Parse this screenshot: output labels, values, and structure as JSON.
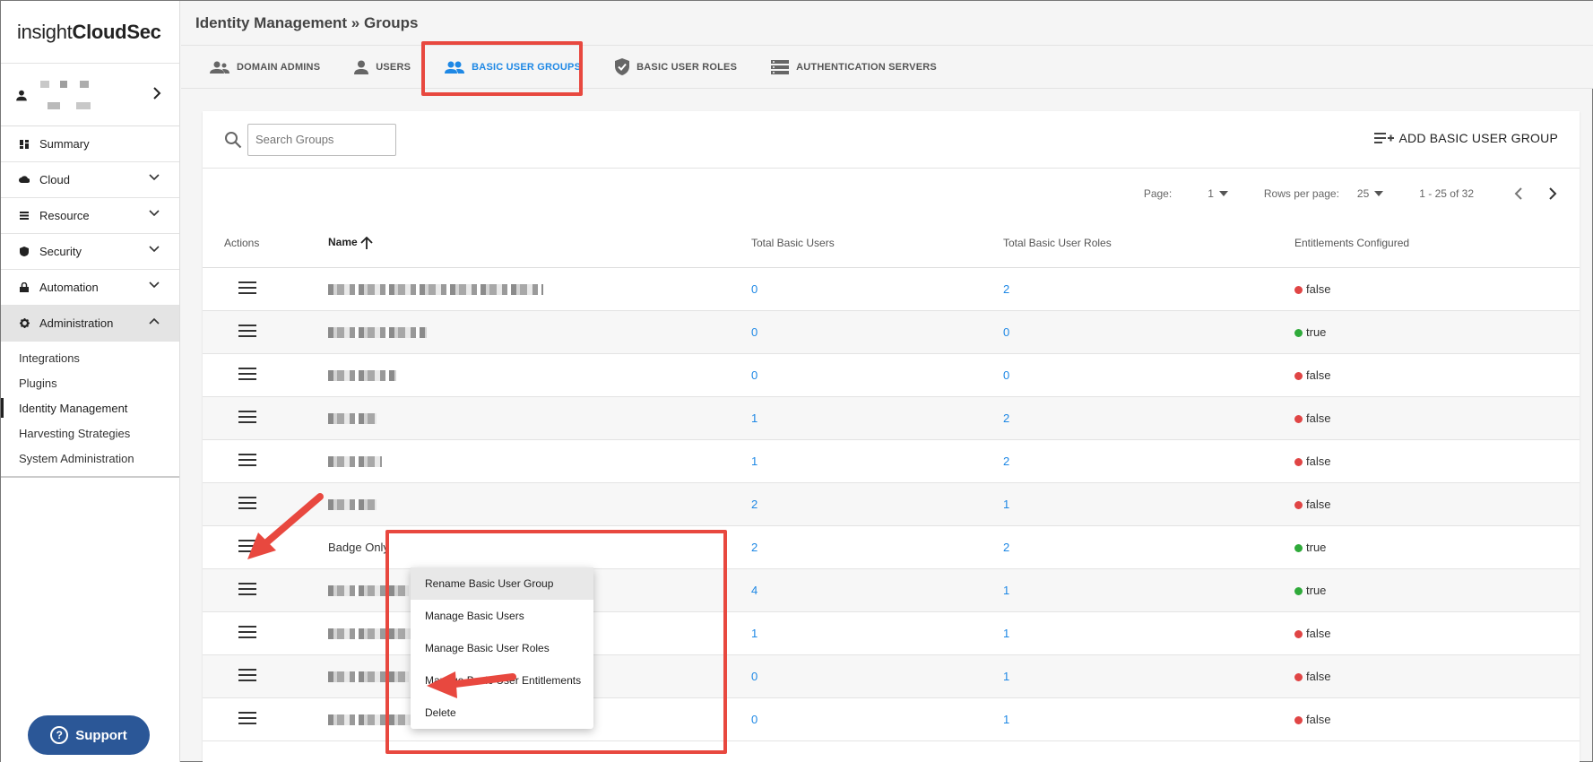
{
  "logo": {
    "prefix": "insight",
    "bold": "CloudSec"
  },
  "sidebar": {
    "items": [
      {
        "label": "Summary"
      },
      {
        "label": "Cloud"
      },
      {
        "label": "Resource"
      },
      {
        "label": "Security"
      },
      {
        "label": "Automation"
      },
      {
        "label": "Administration"
      }
    ],
    "subitems": [
      {
        "label": "Integrations"
      },
      {
        "label": "Plugins"
      },
      {
        "label": "Identity Management"
      },
      {
        "label": "Harvesting Strategies"
      },
      {
        "label": "System Administration"
      }
    ]
  },
  "support": {
    "label": "Support"
  },
  "breadcrumb": "Identity Management » Groups",
  "tabs": [
    {
      "label": "DOMAIN ADMINS",
      "icon": "user-group-icon"
    },
    {
      "label": "USERS",
      "icon": "user-icon"
    },
    {
      "label": "BASIC USER GROUPS",
      "icon": "people-icon"
    },
    {
      "label": "BASIC USER ROLES",
      "icon": "shield-icon"
    },
    {
      "label": "AUTHENTICATION SERVERS",
      "icon": "server-icon"
    }
  ],
  "search": {
    "placeholder": "Search Groups"
  },
  "add_button": {
    "label": "ADD BASIC USER GROUP"
  },
  "pager": {
    "page_label": "Page:",
    "page": "1",
    "rows_label": "Rows per page:",
    "rows": "25",
    "range": "1 - 25 of 32"
  },
  "table": {
    "headers": {
      "actions": "Actions",
      "name": "Name",
      "users": "Total Basic Users",
      "roles": "Total Basic User Roles",
      "entitlements": "Entitlements Configured"
    },
    "rows": [
      {
        "name": "",
        "users": "0",
        "roles": "2",
        "ent": "false"
      },
      {
        "name": "",
        "users": "0",
        "roles": "0",
        "ent": "true"
      },
      {
        "name": "",
        "users": "0",
        "roles": "0",
        "ent": "false"
      },
      {
        "name": "",
        "users": "1",
        "roles": "2",
        "ent": "false"
      },
      {
        "name": "",
        "users": "1",
        "roles": "2",
        "ent": "false"
      },
      {
        "name": "",
        "users": "2",
        "roles": "1",
        "ent": "false"
      },
      {
        "name": "Badge Only",
        "users": "2",
        "roles": "2",
        "ent": "true"
      },
      {
        "name": "",
        "users": "4",
        "roles": "1",
        "ent": "true"
      },
      {
        "name": "",
        "users": "1",
        "roles": "1",
        "ent": "false"
      },
      {
        "name": "",
        "users": "0",
        "roles": "1",
        "ent": "false"
      },
      {
        "name": "",
        "users": "0",
        "roles": "1",
        "ent": "false"
      }
    ]
  },
  "menu": {
    "items": [
      {
        "label": "Rename Basic User Group"
      },
      {
        "label": "Manage Basic Users"
      },
      {
        "label": "Manage Basic User Roles"
      },
      {
        "label": "Manage Basic User Entitlements"
      },
      {
        "label": "Delete"
      }
    ]
  },
  "colors": {
    "accent": "#1e88e5",
    "annotation": "#e8483f",
    "false_dot": "#e04545",
    "true_dot": "#2faa3a",
    "support": "#2b5797"
  }
}
